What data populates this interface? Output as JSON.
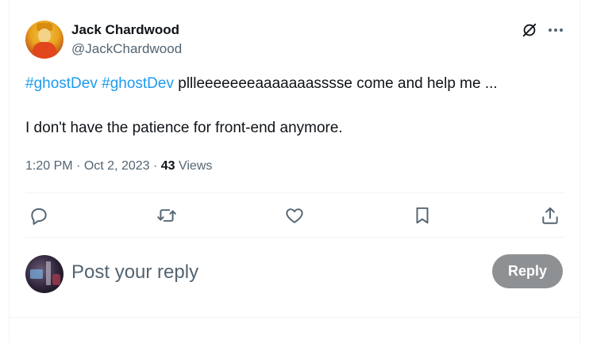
{
  "tweet": {
    "author": {
      "name": "Jack Chardwood",
      "handle": "@JackChardwood"
    },
    "text": {
      "hashtags": [
        "#ghostDev",
        "#ghostDev"
      ],
      "line1_rest": " pllleeeeeeeaaaaaaasssse come and help me ...",
      "line2": "I don't have the patience for front-end anymore."
    },
    "meta": {
      "time": "1:20 PM",
      "separator": " · ",
      "date": "Oct 2, 2023",
      "views_count": "43",
      "views_label": " Views"
    },
    "icons": {
      "grok": "grok-icon",
      "more": "more-icon",
      "reply": "reply-icon",
      "retweet": "retweet-icon",
      "like": "heart-icon",
      "bookmark": "bookmark-icon",
      "share": "share-icon"
    }
  },
  "composer": {
    "placeholder": "Post your reply",
    "value": "",
    "button_label": "Reply",
    "button_color": "#8e9193"
  },
  "colors": {
    "accent": "#1d9bf0",
    "text_primary": "#0f1419",
    "text_secondary": "#536471",
    "divider": "#eff3f4"
  }
}
